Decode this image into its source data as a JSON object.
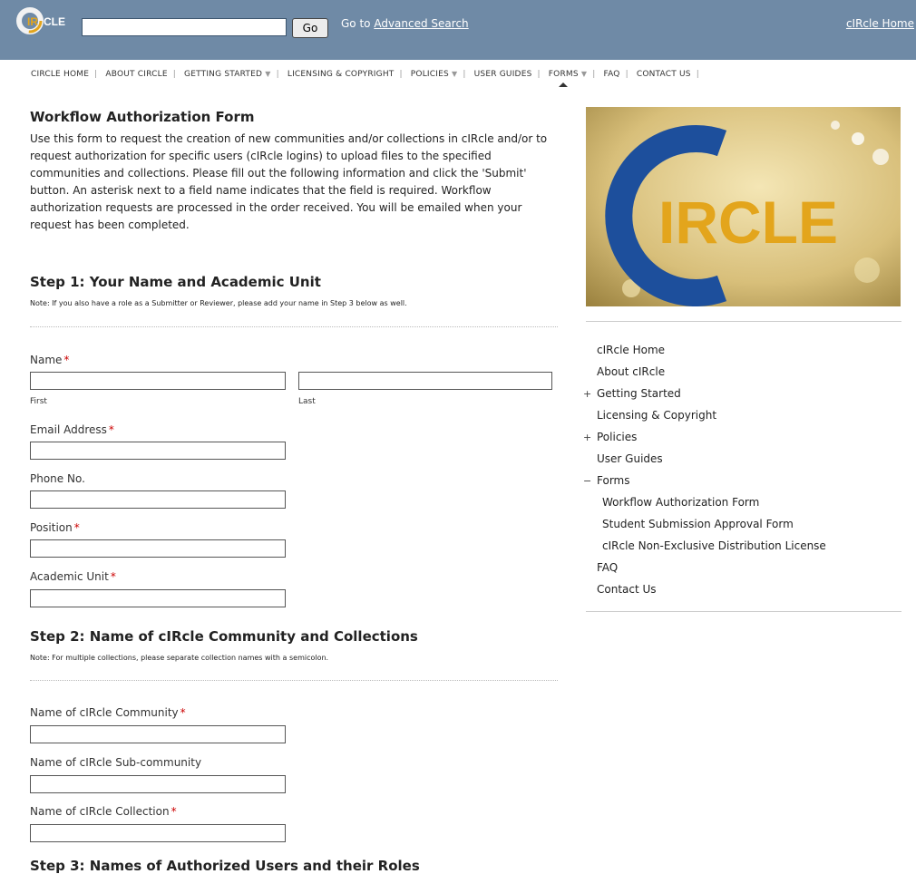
{
  "header": {
    "logo_text": "CIRCLE",
    "search_placeholder": "",
    "go_label": "Go",
    "goto_prefix": "Go to",
    "advanced_search": "Advanced Search",
    "home_link": "cIRcle Home"
  },
  "nav": {
    "items": [
      {
        "label": "CIRCLE HOME"
      },
      {
        "label": "ABOUT CIRCLE"
      },
      {
        "label": "GETTING STARTED"
      },
      {
        "label": "LICENSING & COPYRIGHT"
      },
      {
        "label": "POLICIES"
      },
      {
        "label": "USER GUIDES"
      },
      {
        "label": "FORMS"
      },
      {
        "label": "FAQ"
      },
      {
        "label": "CONTACT US"
      }
    ]
  },
  "form": {
    "title": "Workflow Authorization Form",
    "intro": "Use this form to request the creation of new communities and/or collections in cIRcle and/or to request authorization for specific users (cIRcle logins) to upload files to the specified communities and collections. Please fill out the following information and click the 'Submit' button. An asterisk next to a field name indicates that the field is required. Workflow authorization requests are processed in the order received. You will be emailed when your request has been completed.",
    "step1": {
      "heading": "Step 1: Your Name and Academic Unit",
      "note": "Note: If you also have a role as a Submitter or Reviewer, please add your name in Step 3 below as well.",
      "name_label": "Name",
      "first_label": "First",
      "last_label": "Last",
      "email_label": "Email Address",
      "phone_label": "Phone No.",
      "position_label": "Position",
      "unit_label": "Academic Unit"
    },
    "step2": {
      "heading": "Step 2: Name of cIRcle Community and Collections",
      "note": "Note: For multiple collections, please separate collection names with a semicolon.",
      "community_label": "Name of cIRcle Community",
      "subcommunity_label": "Name of cIRcle Sub-community",
      "collection_label": "Name of cIRcle Collection"
    },
    "step3_partial": "Step 3: Names of Authorized Users and their Roles"
  },
  "sidebar": {
    "banner_text": "IRCLE",
    "menu": [
      {
        "label": "cIRcle Home"
      },
      {
        "label": "About cIRcle"
      },
      {
        "label": "Getting Started",
        "toggle": "+"
      },
      {
        "label": "Licensing & Copyright"
      },
      {
        "label": "Policies",
        "toggle": "+"
      },
      {
        "label": "User Guides"
      },
      {
        "label": "Forms",
        "toggle": "−"
      },
      {
        "label": "Workflow Authorization Form"
      },
      {
        "label": "Student Submission Approval Form"
      },
      {
        "label": "cIRcle Non-Exclusive Distribution License"
      },
      {
        "label": "FAQ"
      },
      {
        "label": "Contact Us"
      }
    ]
  },
  "colors": {
    "topbar": "#6f8aa6",
    "accent_blue": "#1d4f9c",
    "accent_gold": "#e3a51c",
    "required": "#cc0000"
  }
}
